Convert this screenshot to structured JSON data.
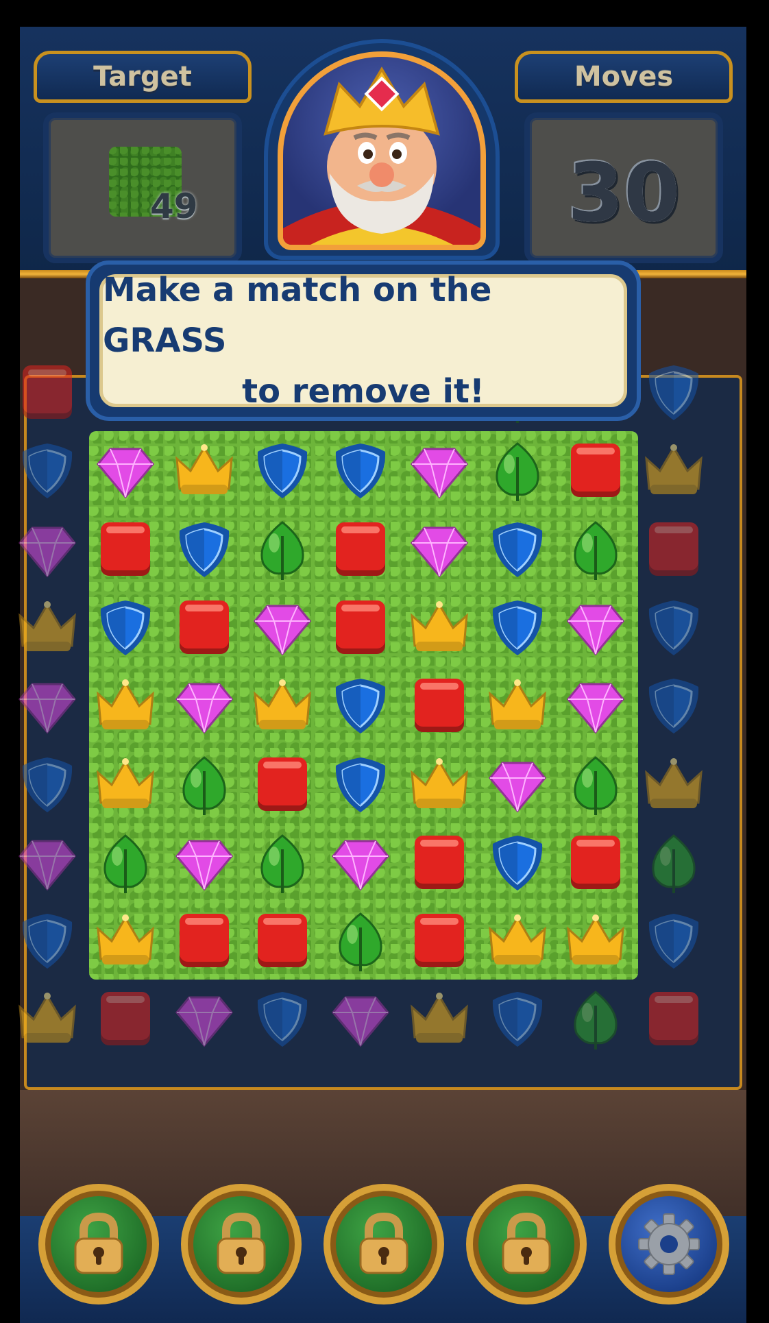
{
  "header": {
    "target_label": "Target",
    "target_count": "49",
    "moves_label": "Moves",
    "moves_value": "30"
  },
  "tooltip": {
    "line1": "Make a match on the GRASS",
    "line2": "to remove it!"
  },
  "colors": {
    "red": "#e2231f",
    "blue": "#1a6fe0",
    "green": "#2fa82b",
    "pink": "#e24be6",
    "yellow": "#f7b61c",
    "grass": "#6db53a"
  },
  "board": {
    "cols": 9,
    "rows": 9,
    "grass_region": {
      "row_start": 1,
      "row_end": 7,
      "col_start": 1,
      "col_end": 7
    },
    "tiles": [
      [
        "red",
        "pink",
        "yellow",
        "blue",
        "blue",
        "pink",
        "green",
        "red",
        "blue"
      ],
      [
        "blue",
        "pink",
        "yellow",
        "blue",
        "blue",
        "pink",
        "green",
        "red",
        "yellow"
      ],
      [
        "pink",
        "red",
        "blue",
        "green",
        "red",
        "pink",
        "blue",
        "green",
        "red"
      ],
      [
        "yellow",
        "blue",
        "red",
        "pink",
        "red",
        "yellow",
        "blue",
        "pink",
        "blue"
      ],
      [
        "pink",
        "yellow",
        "pink",
        "yellow",
        "blue",
        "red",
        "yellow",
        "pink",
        "blue"
      ],
      [
        "blue",
        "yellow",
        "green",
        "red",
        "blue",
        "yellow",
        "pink",
        "green",
        "yellow"
      ],
      [
        "pink",
        "green",
        "pink",
        "green",
        "pink",
        "red",
        "blue",
        "red",
        "green"
      ],
      [
        "blue",
        "yellow",
        "red",
        "red",
        "green",
        "red",
        "yellow",
        "yellow",
        "blue"
      ],
      [
        "yellow",
        "red",
        "pink",
        "blue",
        "pink",
        "yellow",
        "blue",
        "green",
        "red"
      ]
    ]
  },
  "boosters": [
    {
      "name": "locked-booster-1",
      "icon": "lock-icon"
    },
    {
      "name": "locked-booster-2",
      "icon": "lock-icon"
    },
    {
      "name": "locked-booster-3",
      "icon": "lock-icon"
    },
    {
      "name": "locked-booster-4",
      "icon": "lock-icon"
    },
    {
      "name": "settings",
      "icon": "gear-icon"
    }
  ]
}
